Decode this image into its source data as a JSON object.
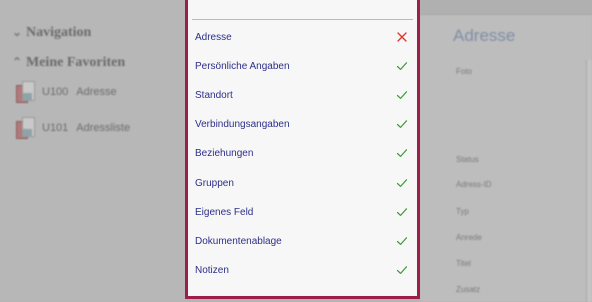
{
  "sidebar": {
    "navigation_label": "Navigation",
    "favorites_label": "Meine Favoriten",
    "favorites": [
      {
        "code": "U100",
        "label": "Adresse"
      },
      {
        "code": "U101",
        "label": "Adressliste"
      }
    ]
  },
  "menu": {
    "items": [
      {
        "label": "Adresse",
        "status": "x-icon",
        "status_color": "#e0362c"
      },
      {
        "label": "Persönliche Angaben",
        "status": "check-icon",
        "status_color": "#3f9a3c"
      },
      {
        "label": "Standort",
        "status": "check-icon",
        "status_color": "#3f9a3c"
      },
      {
        "label": "Verbindungsangaben",
        "status": "check-icon",
        "status_color": "#3f9a3c"
      },
      {
        "label": "Beziehungen",
        "status": "check-icon",
        "status_color": "#3f9a3c"
      },
      {
        "label": "Gruppen",
        "status": "check-icon",
        "status_color": "#3f9a3c"
      },
      {
        "label": "Eigenes Feld",
        "status": "check-icon",
        "status_color": "#3f9a3c"
      },
      {
        "label": "Dokumentenablage",
        "status": "check-icon",
        "status_color": "#3f9a3c"
      },
      {
        "label": "Notizen",
        "status": "check-icon",
        "status_color": "#3f9a3c"
      }
    ]
  },
  "detail": {
    "title": "Adresse",
    "fields": [
      "Foto",
      "Status",
      "Adress-ID",
      "Typ",
      "Anrede",
      "Titel",
      "Zusatz"
    ]
  },
  "colors": {
    "accent_border": "#9b1f4a",
    "menu_text": "#2d2f8a",
    "check": "#3f9a3c",
    "cross": "#e0362c"
  }
}
